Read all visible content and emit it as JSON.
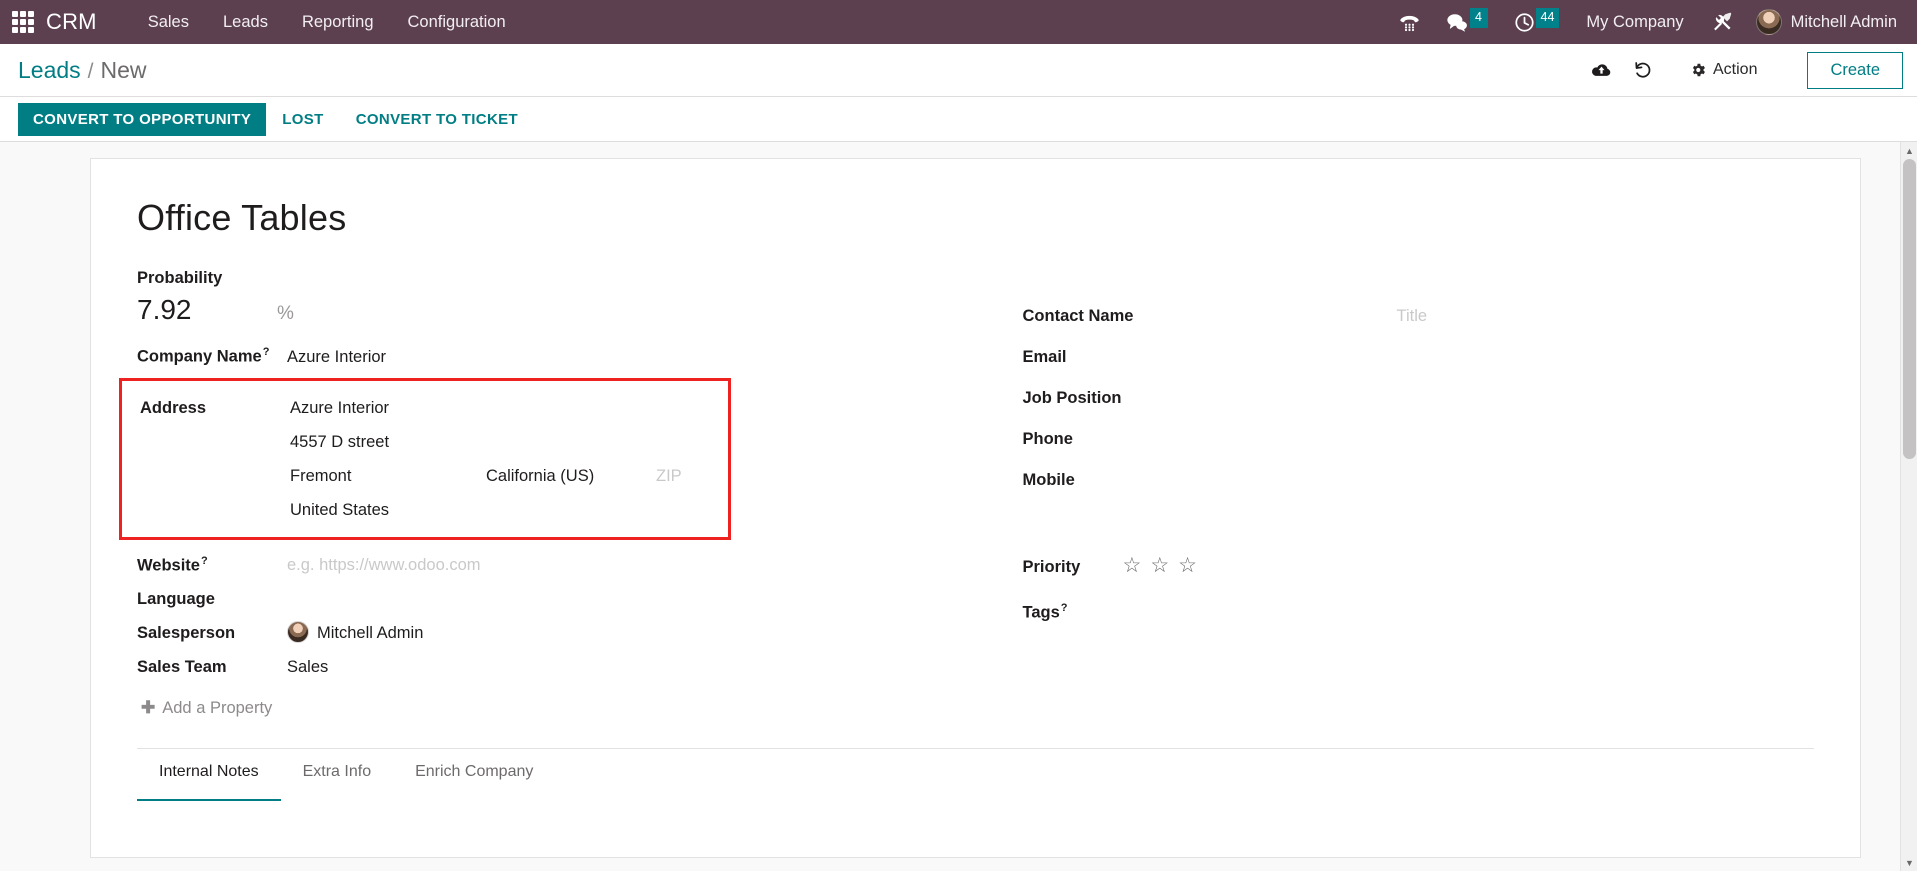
{
  "navbar": {
    "apps_icon": "apps-grid-icon",
    "brand": "CRM",
    "menu_items": [
      {
        "label": "Sales"
      },
      {
        "label": "Leads"
      },
      {
        "label": "Reporting"
      },
      {
        "label": "Configuration"
      }
    ],
    "systray": {
      "phone_icon": "voip-dialpad-icon",
      "messages_icon": "messages-icon",
      "messages_count": "4",
      "activities_icon": "activities-clock-icon",
      "activities_count": "44",
      "company": "My Company",
      "tools_icon": "debug-tools-icon",
      "user_name": "Mitchell Admin",
      "avatar": "user-avatar"
    },
    "accent_color": "#01828b",
    "background_color": "#5c4050"
  },
  "control_panel": {
    "breadcrumb_root": "Leads",
    "breadcrumb_separator": "/",
    "breadcrumb_current": "New",
    "save_icon": "cloud-upload-save-icon",
    "discard_icon": "undo-discard-icon",
    "action_icon": "gear-icon",
    "action_label": "Action",
    "create_label": "Create",
    "accent_color": "#017e84"
  },
  "statusbar": {
    "buttons": [
      {
        "label": "CONVERT TO OPPORTUNITY",
        "primary": true
      },
      {
        "label": "LOST",
        "primary": false
      },
      {
        "label": "CONVERT TO TICKET",
        "primary": false
      }
    ]
  },
  "form": {
    "title": "Office Tables",
    "probability": {
      "label": "Probability",
      "value": "7.92",
      "unit": "%"
    },
    "company_name": {
      "label": "Company Name",
      "help": "?",
      "value": "Azure Interior"
    },
    "address": {
      "label": "Address",
      "highlighted": true,
      "highlight_color": "#ef2222",
      "line1": "Azure Interior",
      "line2": "4557 D street",
      "city": "Fremont",
      "state": "California (US)",
      "zip_placeholder": "ZIP",
      "country": "United States"
    },
    "website": {
      "label": "Website",
      "help": "?",
      "placeholder": "e.g. https://www.odoo.com"
    },
    "language": {
      "label": "Language",
      "value": ""
    },
    "salesperson": {
      "label": "Salesperson",
      "value": "Mitchell Admin",
      "avatar": "salesperson-avatar"
    },
    "sales_team": {
      "label": "Sales Team",
      "value": "Sales"
    },
    "add_property": {
      "icon": "plus-icon",
      "label": "Add a Property"
    },
    "contact_name": {
      "label": "Contact Name",
      "value": "",
      "title_placeholder": "Title"
    },
    "email": {
      "label": "Email",
      "value": ""
    },
    "job_position": {
      "label": "Job Position",
      "value": ""
    },
    "phone": {
      "label": "Phone",
      "value": ""
    },
    "mobile": {
      "label": "Mobile",
      "value": ""
    },
    "priority": {
      "label": "Priority",
      "stars": [
        "☆",
        "☆",
        "☆"
      ],
      "value": 0
    },
    "tags": {
      "label": "Tags",
      "help": "?",
      "value": ""
    }
  },
  "notebook": {
    "tabs": [
      {
        "label": "Internal Notes",
        "active": true
      },
      {
        "label": "Extra Info",
        "active": false
      },
      {
        "label": "Enrich Company",
        "active": false
      }
    ]
  },
  "scrollbar": {
    "up_arrow": "chevron-up-icon",
    "down_arrow": "chevron-down-icon"
  }
}
